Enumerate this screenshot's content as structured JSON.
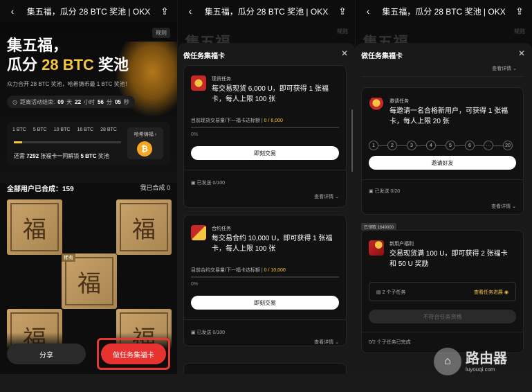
{
  "topbar": {
    "title": "集五福，瓜分 28 BTC 奖池 | OKX"
  },
  "panel1": {
    "rules": "规则",
    "headline1": "集五福，",
    "headline2_prefix": "瓜分 ",
    "headline2_amount": "28 BTC",
    "headline2_suffix": " 奖池",
    "subtitle": "众力合开 28 BTC 奖池，哈希铸币最 1 BTC 奖池！",
    "countdown": {
      "label": "距离活动结束:",
      "days": "09",
      "days_unit": "天",
      "hours": "22",
      "hours_unit": "小时",
      "minutes": "56",
      "minutes_unit": "分",
      "seconds": "05",
      "seconds_unit": "秒"
    },
    "ticks": [
      "1 BTC",
      "5 BTC",
      "10 BTC",
      "16 BTC",
      "28 BTC"
    ],
    "progress_fraction": 0.08,
    "unlock_prefix": "还需 ",
    "unlock_count": "7292",
    "unlock_middle": " 张福卡一同解锁 ",
    "unlock_amount": "5 BTC",
    "unlock_suffix": " 奖池",
    "cabinet_label": "哈希铸福",
    "btc_symbol": "₿",
    "synth_label": "全部用户已合成：",
    "synth_count": "159",
    "synth_mine": "我已合成 0",
    "fu_char": "福",
    "rare_tag": "稀有",
    "share_button": "分享",
    "task_button": "做任务集福卡"
  },
  "bg": {
    "title": "集五福",
    "rules": "规则"
  },
  "sheet": {
    "title": "做任务集福卡"
  },
  "spot_task": {
    "tag": "现货任务",
    "desc": "每交易现货 6,000 U，即可获得 1 张福卡，每人上限 100 张",
    "progress_label": "目前现货交易量/下一福卡达标额",
    "progress_value": "0 / 6,000",
    "percent": "0%",
    "action": "即刻交易",
    "sent": "已发送 0/100",
    "details": "查看详情"
  },
  "contract_task": {
    "tag": "合约任务",
    "desc": "每交易合约 10,000 U，即可获得 1 张福卡，每人上限 100 张",
    "progress_label": "目前合约交易量/下一福卡达标额",
    "progress_value": "0 / 10,000",
    "percent": "0%",
    "action": "即刻交易",
    "sent": "已发送 0/100",
    "details": "查看详情"
  },
  "invite_task": {
    "top_details": "查看详情",
    "tag": "邀请任务",
    "desc": "每邀请一名合格新用户，可获得 1 张福卡，每人上限 20 张",
    "steps": [
      "1",
      "2",
      "3",
      "4",
      "5",
      "6",
      "···",
      "20"
    ],
    "action": "邀请好友",
    "sent": "已发送 0/20",
    "details": "查看详情"
  },
  "newuser_task": {
    "badge": "已领取 1649000",
    "tag": "新用户福利",
    "desc": "交易现货满 100 U，即可获得 2 张福卡 和 50 U 奖励",
    "subtasks": "2 个子任务",
    "view": "查看任务进展",
    "disabled": "不符合任务资格",
    "done": "0/2 个子任务已完成"
  },
  "watermark": {
    "name": "路由器",
    "url": "luyouqi.com"
  }
}
